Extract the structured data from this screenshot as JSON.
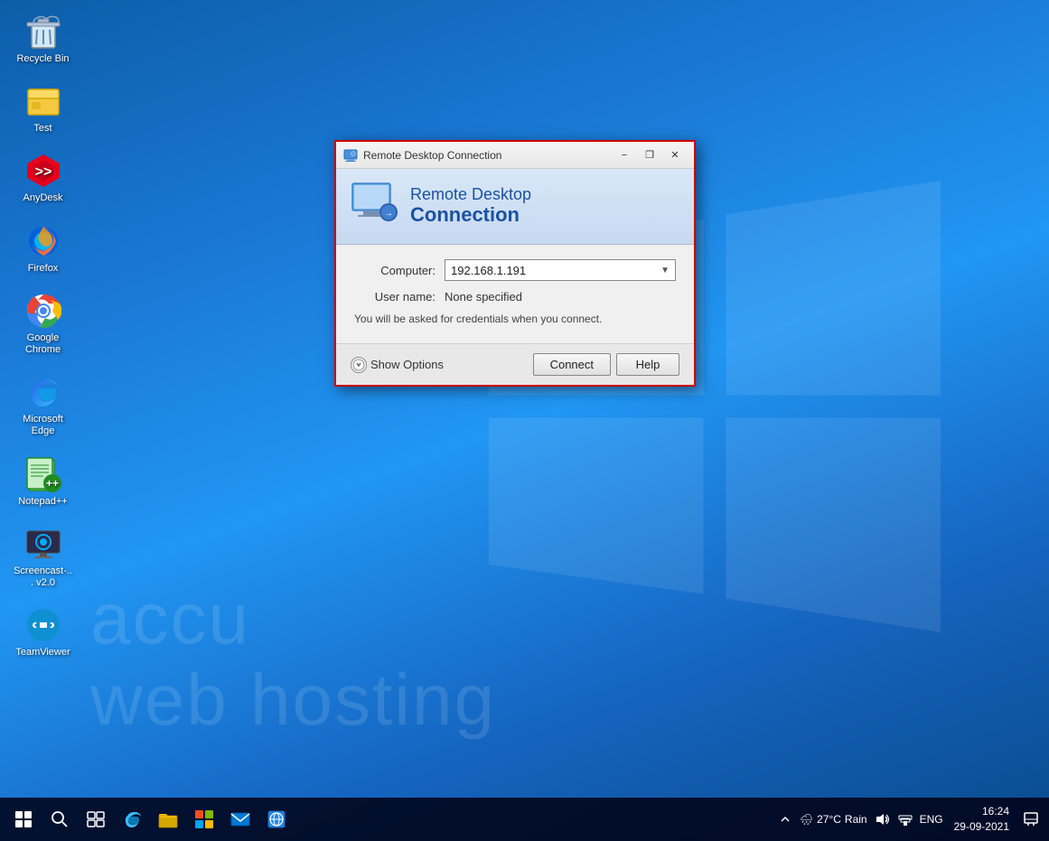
{
  "desktop": {
    "background_color_start": "#0d5ea8",
    "background_color_end": "#1565c0",
    "watermark_line1": "accu",
    "watermark_line2": "web hosting"
  },
  "desktop_icons": [
    {
      "id": "recycle-bin",
      "label": "Recycle Bin",
      "icon_type": "recycle_bin"
    },
    {
      "id": "test",
      "label": "Test",
      "icon_type": "folder"
    },
    {
      "id": "anydesk",
      "label": "AnyDesk",
      "icon_type": "anydesk"
    },
    {
      "id": "firefox",
      "label": "Firefox",
      "icon_type": "firefox"
    },
    {
      "id": "google-chrome",
      "label": "Google Chrome",
      "icon_type": "chrome"
    },
    {
      "id": "microsoft-edge",
      "label": "Microsoft Edge",
      "icon_type": "edge"
    },
    {
      "id": "notepadpp",
      "label": "Notepad++",
      "icon_type": "notepadpp"
    },
    {
      "id": "screencast",
      "label": "Screencast-... v2.0",
      "icon_type": "screencast"
    },
    {
      "id": "teamviewer",
      "label": "TeamViewer",
      "icon_type": "teamviewer"
    }
  ],
  "rdp_dialog": {
    "title": "Remote Desktop Connection",
    "header_line1": "Remote Desktop",
    "header_line2": "Connection",
    "computer_label": "Computer:",
    "computer_value": "192.168.1.191",
    "username_label": "User name:",
    "username_value": "None specified",
    "credentials_note": "You will be asked for credentials when you connect.",
    "show_options_label": "Show Options",
    "connect_button": "Connect",
    "help_button": "Help",
    "minimize_button": "−",
    "restore_button": "❐",
    "close_button": "✕"
  },
  "taskbar": {
    "items": [
      {
        "id": "search",
        "icon": "⊙",
        "label": "Search"
      },
      {
        "id": "task-view",
        "icon": "⊞",
        "label": "Task View"
      },
      {
        "id": "edge",
        "icon": "🌐",
        "label": "Microsoft Edge"
      },
      {
        "id": "file-explorer",
        "icon": "📁",
        "label": "File Explorer"
      },
      {
        "id": "store",
        "icon": "🛍",
        "label": "Microsoft Store"
      },
      {
        "id": "mail",
        "icon": "✉",
        "label": "Mail"
      },
      {
        "id": "network",
        "icon": "🌐",
        "label": "Network"
      }
    ],
    "tray": {
      "weather_temp": "27°C",
      "weather_condition": "Rain",
      "time": "16:24",
      "date": "29-09-2021",
      "language": "ENG"
    }
  }
}
